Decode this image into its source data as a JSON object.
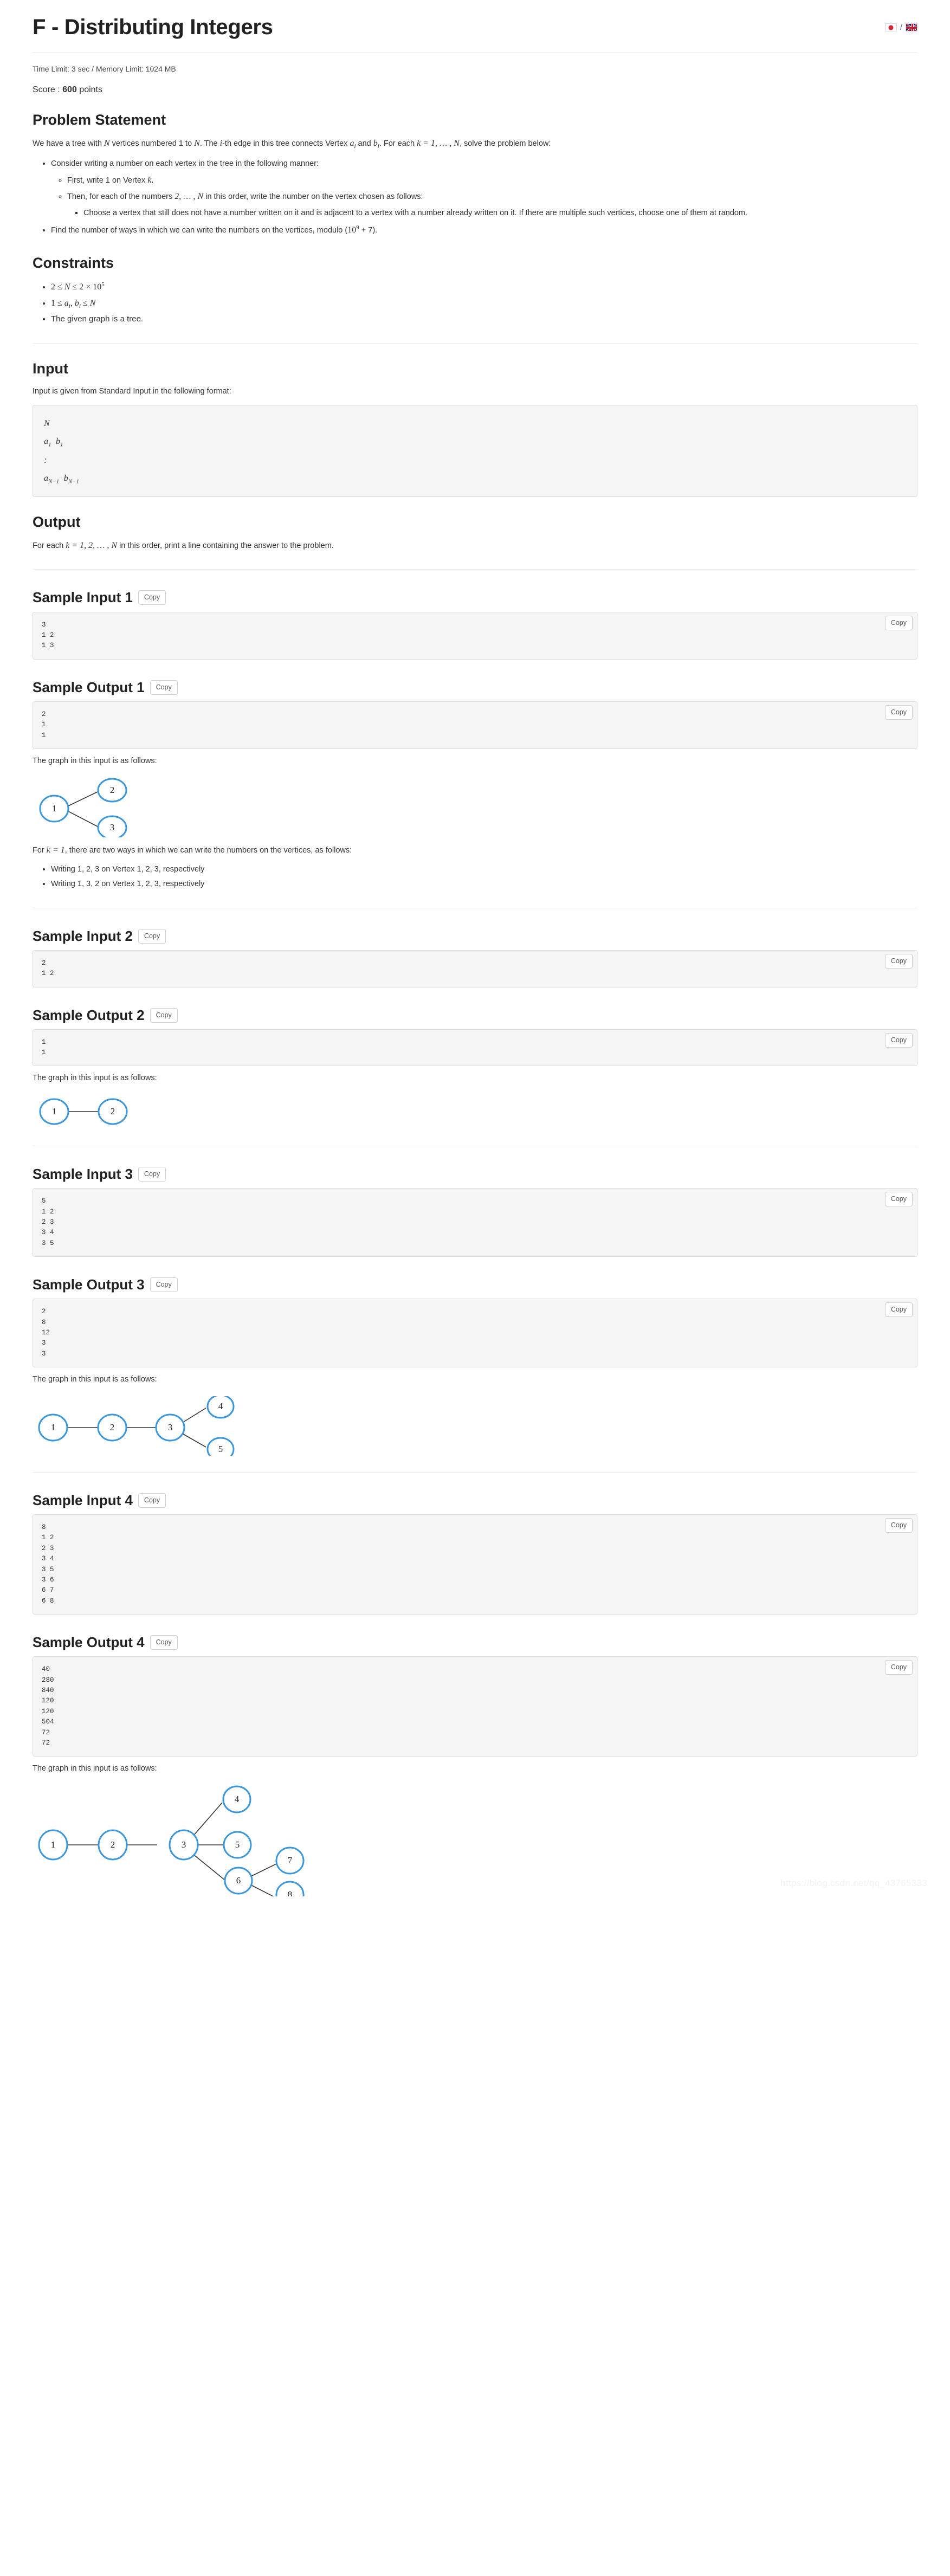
{
  "header": {
    "problem_title": "F - Distributing Integers",
    "lang_jp": "jp-flag-icon",
    "lang_sep": "/",
    "lang_en": "uk-flag-icon"
  },
  "meta": {
    "limits": "Time Limit: 3 sec / Memory Limit: 1024 MB",
    "score_label": "Score : ",
    "score_value": "600",
    "score_suffix": " points"
  },
  "sections": {
    "problem_statement": "Problem Statement",
    "constraints": "Constraints",
    "input": "Input",
    "output": "Output"
  },
  "statement": {
    "intro_1": "We have a tree with ",
    "intro_N": "N",
    "intro_2": " vertices numbered 1 to ",
    "intro_3": ". The ",
    "intro_i": "i",
    "intro_4": "-th edge in this tree connects Vertex ",
    "intro_a": "a",
    "intro_a_sub": "i",
    "intro_5": " and ",
    "intro_b": "b",
    "intro_b_sub": "i",
    "intro_6": ". For each ",
    "intro_k": "k = 1, … , N",
    "intro_7": ", solve the problem below:",
    "bullet_1": "Consider writing a number on each vertex in the tree in the following manner:",
    "sub_1_pre": "First, write 1 on Vertex ",
    "sub_1_k": "k",
    "sub_1_post": ".",
    "sub_2_pre": "Then, for each of the numbers ",
    "sub_2_math": "2, … , N",
    "sub_2_post": " in this order, write the number on the vertex chosen as follows:",
    "sub_sub_1": "Choose a vertex that still does not have a number written on it and is adjacent to a vertex with a number already written on it. If there are multiple such vertices, choose one of them at random.",
    "bullet_2_pre": "Find the number of ways in which we can write the numbers on the vertices, modulo (",
    "bullet_2_mod_base": "10",
    "bullet_2_mod_exp": "9",
    "bullet_2_post": " + 7)."
  },
  "constraints_list": [
    "2 ≤ N ≤ 2 × 10^5",
    "1 ≤ a_i, b_i ≤ N",
    "The given graph is a tree."
  ],
  "input_section": {
    "desc": "Input is given from Standard Input in the following format:",
    "format_lines": [
      "N",
      "a₁  b₁",
      ":",
      "a_{N−1}  b_{N−1}"
    ]
  },
  "output_section": {
    "desc_pre": "For each ",
    "desc_math": "k = 1, 2, … , N",
    "desc_post": " in this order, print a line containing the answer to the problem."
  },
  "copy_label": "Copy",
  "graph_caption": "The graph in this input is as follows:",
  "samples": [
    {
      "input_heading": "Sample Input 1",
      "input_text": "3\n1 2\n1 3",
      "output_heading": "Sample Output 1",
      "output_text": "2\n1\n1",
      "explain_pre": "For ",
      "explain_math": "k = 1",
      "explain_post": ", there are two ways in which we can write the numbers on the vertices, as follows:",
      "explain_bullets": [
        "Writing 1, 2, 3 on Vertex 1, 2, 3, respectively",
        "Writing 1, 3, 2 on Vertex 1, 2, 3, respectively"
      ]
    },
    {
      "input_heading": "Sample Input 2",
      "input_text": "2\n1 2",
      "output_heading": "Sample Output 2",
      "output_text": "1\n1"
    },
    {
      "input_heading": "Sample Input 3",
      "input_text": "5\n1 2\n2 3\n3 4\n3 5",
      "output_heading": "Sample Output 3",
      "output_text": "2\n8\n12\n3\n3"
    },
    {
      "input_heading": "Sample Input 4",
      "input_text": "8\n1 2\n2 3\n3 4\n3 5\n3 6\n6 7\n6 8",
      "output_heading": "Sample Output 4",
      "output_text": "40\n280\n840\n120\n120\n504\n72\n72"
    }
  ],
  "graphs": [
    {
      "nodes": [
        "1",
        "2",
        "3"
      ],
      "edges": [
        [
          1,
          2
        ],
        [
          1,
          3
        ]
      ]
    },
    {
      "nodes": [
        "1",
        "2"
      ],
      "edges": [
        [
          1,
          2
        ]
      ]
    },
    {
      "nodes": [
        "1",
        "2",
        "3",
        "4",
        "5"
      ],
      "edges": [
        [
          1,
          2
        ],
        [
          2,
          3
        ],
        [
          3,
          4
        ],
        [
          3,
          5
        ]
      ]
    },
    {
      "nodes": [
        "1",
        "2",
        "3",
        "4",
        "5",
        "6",
        "7",
        "8"
      ],
      "edges": [
        [
          1,
          2
        ],
        [
          2,
          3
        ],
        [
          3,
          4
        ],
        [
          3,
          5
        ],
        [
          3,
          6
        ],
        [
          6,
          7
        ],
        [
          6,
          8
        ]
      ]
    }
  ],
  "watermark": "https://blog.csdn.net/qq_43765333"
}
